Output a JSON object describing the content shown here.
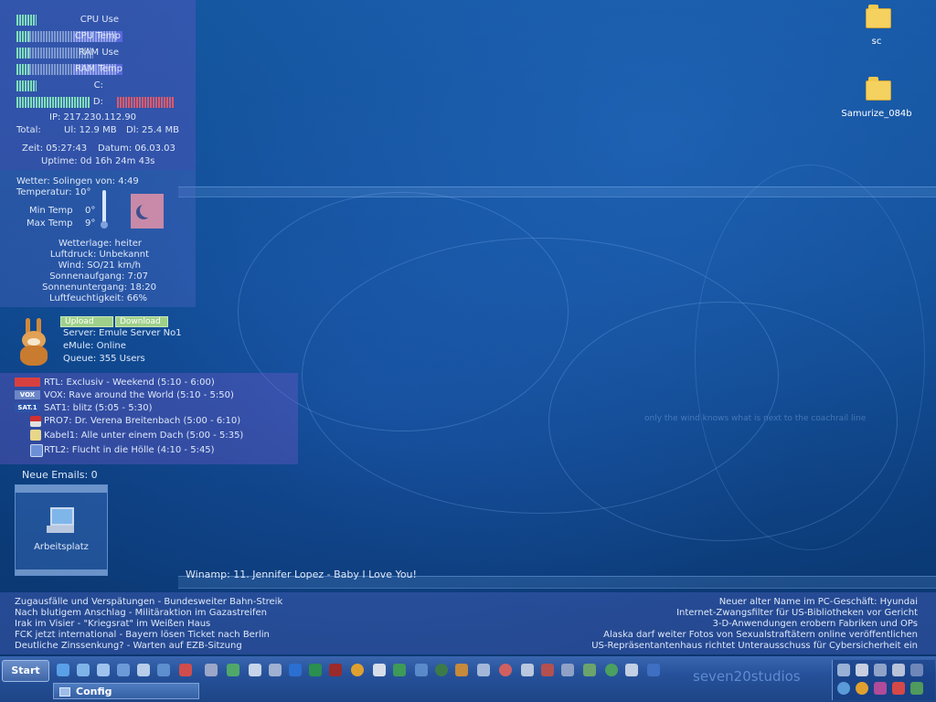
{
  "sysmon": {
    "cpu_use": "CPU Use",
    "cpu_temp": "CPU Temp",
    "ram_use": "RAM Use",
    "ram_temp": "RAM Temp",
    "drive_c": "C:",
    "drive_d": "D:",
    "ip": "IP: 217.230.112.90",
    "total_label": "Total:",
    "ul": "Ul: 12.9 MB",
    "dl": "Dl: 25.4 MB",
    "zeit": "Zeit: 05:27:43",
    "datum": "Datum: 06.03.03",
    "uptime": "Uptime: 0d 16h 24m 43s",
    "levels": {
      "cpu_use": 0.14,
      "cpu_temp": 0.1,
      "ram_use": 0.12,
      "ram_temp": 0.1,
      "drive_c": 0.14,
      "drive_d": 0.52
    }
  },
  "weather": {
    "header": "Wetter: Solingen von: 4:49",
    "temperatur": "Temperatur: 10°",
    "min_label": "Min Temp",
    "min_value": "0°",
    "max_label": "Max Temp",
    "max_value": "9°",
    "wetterlage": "Wetterlage: heiter",
    "luftdruck": "Luftdruck: Unbekannt",
    "wind": "Wind: SO/21 km/h",
    "sonnenaufgang": "Sonnenaufgang: 7:07",
    "sonnenuntergang": "Sonnenuntergang: 18:20",
    "luftfeuchtigkeit": "Luftfeuchtigkeit: 66%"
  },
  "emule": {
    "upload": "Upload",
    "download": "Download",
    "server": "Server: Emule Server No1",
    "status": "eMule: Online",
    "queue": "Queue: 355 Users"
  },
  "tv": [
    {
      "text": "RTL: Exclusiv - Weekend (5:10 - 6:00)"
    },
    {
      "text": "VOX: Rave around the World (5:10 - 5:50)",
      "logo": "VOX"
    },
    {
      "text": "SAT1: blitz (5:05 - 5:30)",
      "logo": "SAT.1"
    },
    {
      "text": "PRO7: Dr. Verena Breitenbach (5:00 - 6:10)"
    },
    {
      "text": "Kabel1: Alle unter einem Dach (5:00 - 5:35)"
    },
    {
      "text": "RTL2: Flucht in die Hölle (4:10 - 5:45)"
    }
  ],
  "email": {
    "label": "Neue Emails: 0"
  },
  "desktop": {
    "arbeitsplatz": "Arbeitsplatz",
    "folder1": "sc",
    "folder2": "Samurize_084b"
  },
  "wallpaper_text": {
    "quote": "only the wind knows what is next to the coachrail line",
    "signature": "seven20studios"
  },
  "winamp": "Winamp: 11. Jennifer Lopez - Baby I Love You!",
  "news_left": [
    "Zugausfälle und Verspätungen - Bundesweiter Bahn-Streik",
    "Nach blutigem Anschlag - Militäraktion im Gazastreifen",
    "Irak im Visier - \"Kriegsrat\" im Weißen Haus",
    "FCK jetzt international - Bayern lösen Ticket nach Berlin",
    "Deutliche Zinssenkung? - Warten auf EZB-Sitzung"
  ],
  "news_right": [
    "Neuer alter Name im PC-Geschäft: Hyundai",
    "Internet-Zwangsfilter für US-Bibliotheken vor Gericht",
    "3-D-Anwendungen erobern Fabriken und OPs",
    "Alaska darf weiter Fotos von Sexualstraftätern online veröffentlichen",
    "US-Repräsentantenhaus richtet Unterausschuss für Cybersicherheit ein"
  ],
  "taskbar": {
    "start": "Start",
    "config_tab": "Config"
  },
  "colors": {
    "meter_green": "#7fe0b8",
    "meter_red": "#e05a6a",
    "panel": "#6e5ac8"
  }
}
